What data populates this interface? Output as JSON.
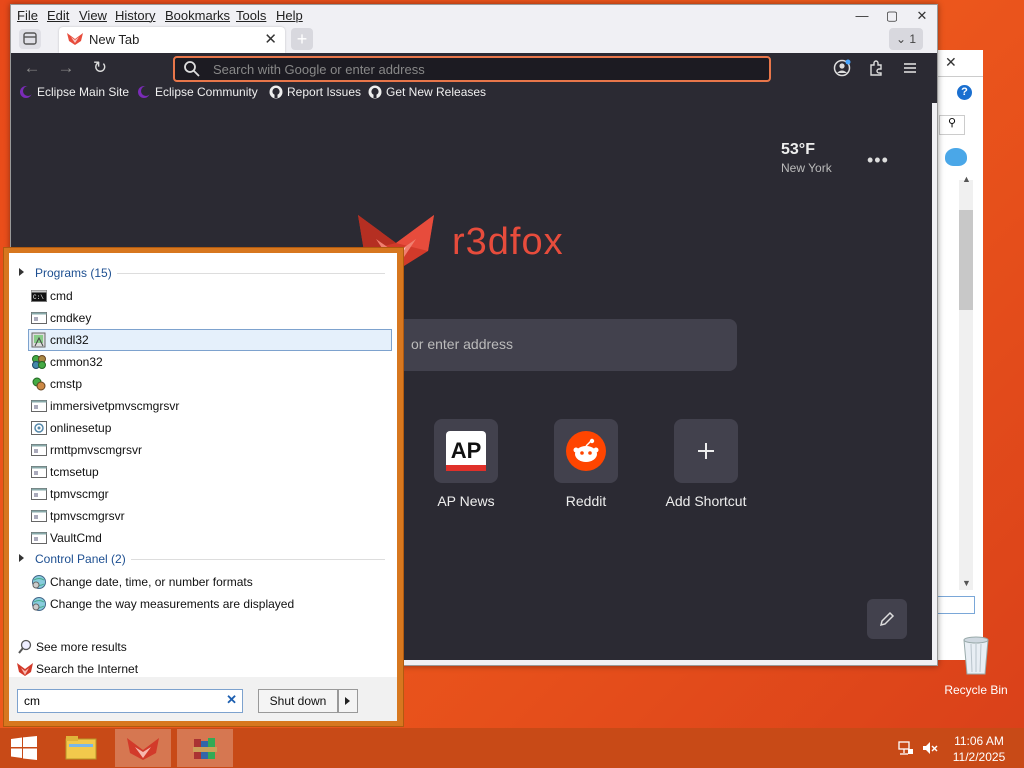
{
  "browser": {
    "menus": [
      "File",
      "Edit",
      "View",
      "History",
      "Bookmarks",
      "Tools",
      "Help"
    ],
    "tab": {
      "title": "New Tab"
    },
    "tab_count": "1",
    "urlbar": {
      "placeholder": "Search with Google or enter address"
    },
    "bookmarks": [
      {
        "label": "Eclipse Main Site",
        "icon": "eclipse-icon"
      },
      {
        "label": "Eclipse Community",
        "icon": "eclipse-icon"
      },
      {
        "label": "Report Issues",
        "icon": "github-icon"
      },
      {
        "label": "Get New Releases",
        "icon": "github-icon"
      }
    ],
    "weather": {
      "temp": "53°F",
      "city": "New York"
    },
    "brand": "r3dfox",
    "search_placeholder_partial": "or enter address",
    "shortcuts": [
      {
        "label": "AP News",
        "icon": "ap-news-icon"
      },
      {
        "label": "Reddit",
        "icon": "reddit-icon"
      },
      {
        "label": "Add Shortcut",
        "icon": "plus-icon"
      }
    ]
  },
  "start_menu": {
    "programs_header": "Programs (15)",
    "programs": [
      "cmd",
      "cmdkey",
      "cmdl32",
      "cmmon32",
      "cmstp",
      "immersivetpmvscmgrsvr",
      "onlinesetup",
      "rmttpmvscmgrsvr",
      "tcmsetup",
      "tpmvscmgr",
      "tpmvscmgrsvr",
      "VaultCmd"
    ],
    "selected_program": "cmdl32",
    "control_panel_header": "Control Panel (2)",
    "control_panel": [
      "Change date, time, or number formats",
      "Change the way measurements are displayed"
    ],
    "see_more": "See more results",
    "search_internet": "Search the Internet",
    "search_value": "cm",
    "shutdown_label": "Shut down"
  },
  "desktop": {
    "recycle_bin": "Recycle Bin"
  },
  "taskbar": {
    "time": "11:06 AM",
    "date": "11/2/2025"
  },
  "colors": {
    "desktop": "#e8491a",
    "taskbar": "#c84a17",
    "browser_dark": "#2b2a33",
    "url_focus": "#e8764a",
    "start_menu_frame": "#d7771f",
    "brand_red": "#e74c3c"
  }
}
